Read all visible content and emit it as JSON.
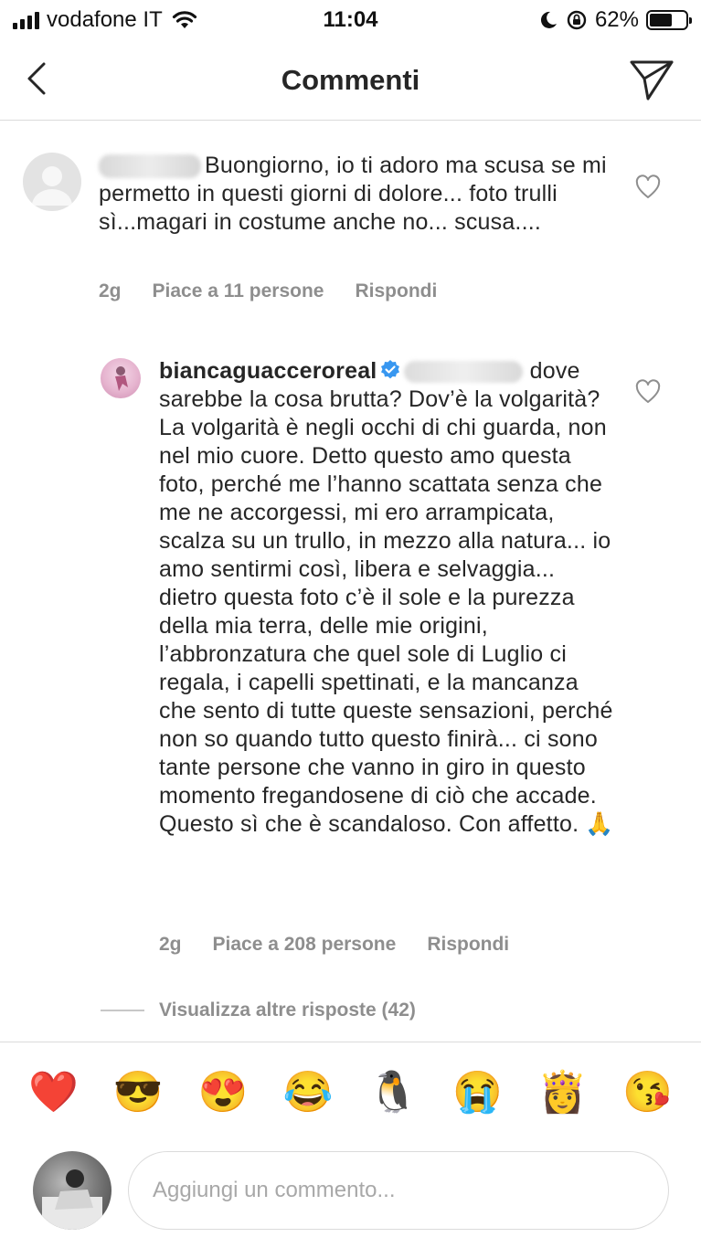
{
  "status_bar": {
    "carrier": "vodafone IT",
    "time": "11:04",
    "battery": "62%",
    "battery_level": 0.62
  },
  "header": {
    "title": "Commenti"
  },
  "comments": [
    {
      "text": "Buongiorno, io ti adoro ma scusa se mi permetto in questi giorni di dolore... foto trulli sì...magari in costume anche no... scusa....",
      "time": "2g",
      "likes": "Piace a 11 persone",
      "reply": "Rispondi"
    },
    {
      "username": "biancaguacceroreal",
      "text": "dove sarebbe la cosa brutta? Dov’è la volgarità? La volgarità è negli occhi di chi guarda, non nel mio cuore. Detto questo amo questa foto, perché me l’hanno scattata senza che me ne accorgessi, mi ero arrampicata, scalza su un trullo, in mezzo alla natura... io amo sentirmi così, libera e selvaggia... dietro questa foto c’è il sole e la purezza della mia terra, delle mie origini, l’abbronzatura che quel sole di Luglio ci regala, i capelli spettinati, e la mancanza che sento di tutte queste sensazioni, perché non so quando tutto questo finirà... ci sono tante persone che vanno in giro in questo momento fregandosene di ciò che accade. Questo sì che è scandaloso. Con affetto. 🙏",
      "time": "2g",
      "likes": "Piace a 208 persone",
      "reply": "Rispondi"
    }
  ],
  "view_more": "Visualizza altre risposte (42)",
  "emojis": [
    "❤️",
    "😎",
    "😍",
    "😂",
    "🐧",
    "😭",
    "👸",
    "😘"
  ],
  "input": {
    "placeholder": "Aggiungi un commento..."
  }
}
